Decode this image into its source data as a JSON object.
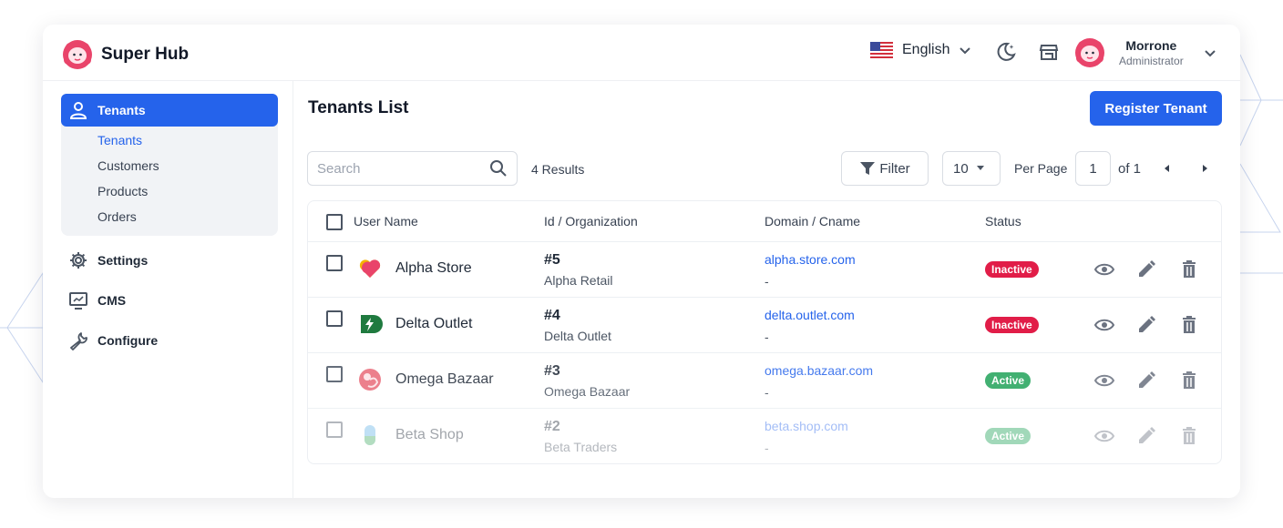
{
  "colors": {
    "primary": "#2563eb",
    "inactive": "#e11d48",
    "active": "#22a35a",
    "brand_pink": "#e9446a"
  },
  "header": {
    "app_title": "Super Hub",
    "language": "English",
    "flag": "us-flag-icon",
    "user": {
      "name": "Morrone",
      "role": "Administrator"
    }
  },
  "sidebar": {
    "group": {
      "label": "Tenants",
      "items": [
        "Tenants",
        "Customers",
        "Products",
        "Orders"
      ]
    },
    "items": [
      {
        "label": "Settings",
        "icon": "gear-icon"
      },
      {
        "label": "CMS",
        "icon": "monitor-icon"
      },
      {
        "label": "Configure",
        "icon": "wrench-icon"
      }
    ]
  },
  "main": {
    "title": "Tenants List",
    "register_label": "Register Tenant",
    "search_placeholder": "Search",
    "results_text": "4 Results",
    "filter_label": "Filter",
    "per_page_value": "10",
    "per_page_label": "Per Page",
    "page_value": "1",
    "page_of": "of 1"
  },
  "table": {
    "headers": [
      "User Name",
      "Id / Organization",
      "Domain / Cname",
      "Status"
    ],
    "rows": [
      {
        "name": "Alpha Store",
        "id": "#5",
        "org": "Alpha Retail",
        "domain": "alpha.store.com",
        "cname": "-",
        "status": "Inactive"
      },
      {
        "name": "Delta Outlet",
        "id": "#4",
        "org": "Delta Outlet",
        "domain": "delta.outlet.com",
        "cname": "-",
        "status": "Inactive"
      },
      {
        "name": "Omega Bazaar",
        "id": "#3",
        "org": "Omega Bazaar",
        "domain": "omega.bazaar.com",
        "cname": "-",
        "status": "Active"
      },
      {
        "name": "Beta Shop",
        "id": "#2",
        "org": "Beta Traders",
        "domain": "beta.shop.com",
        "cname": "-",
        "status": "Active"
      }
    ]
  }
}
